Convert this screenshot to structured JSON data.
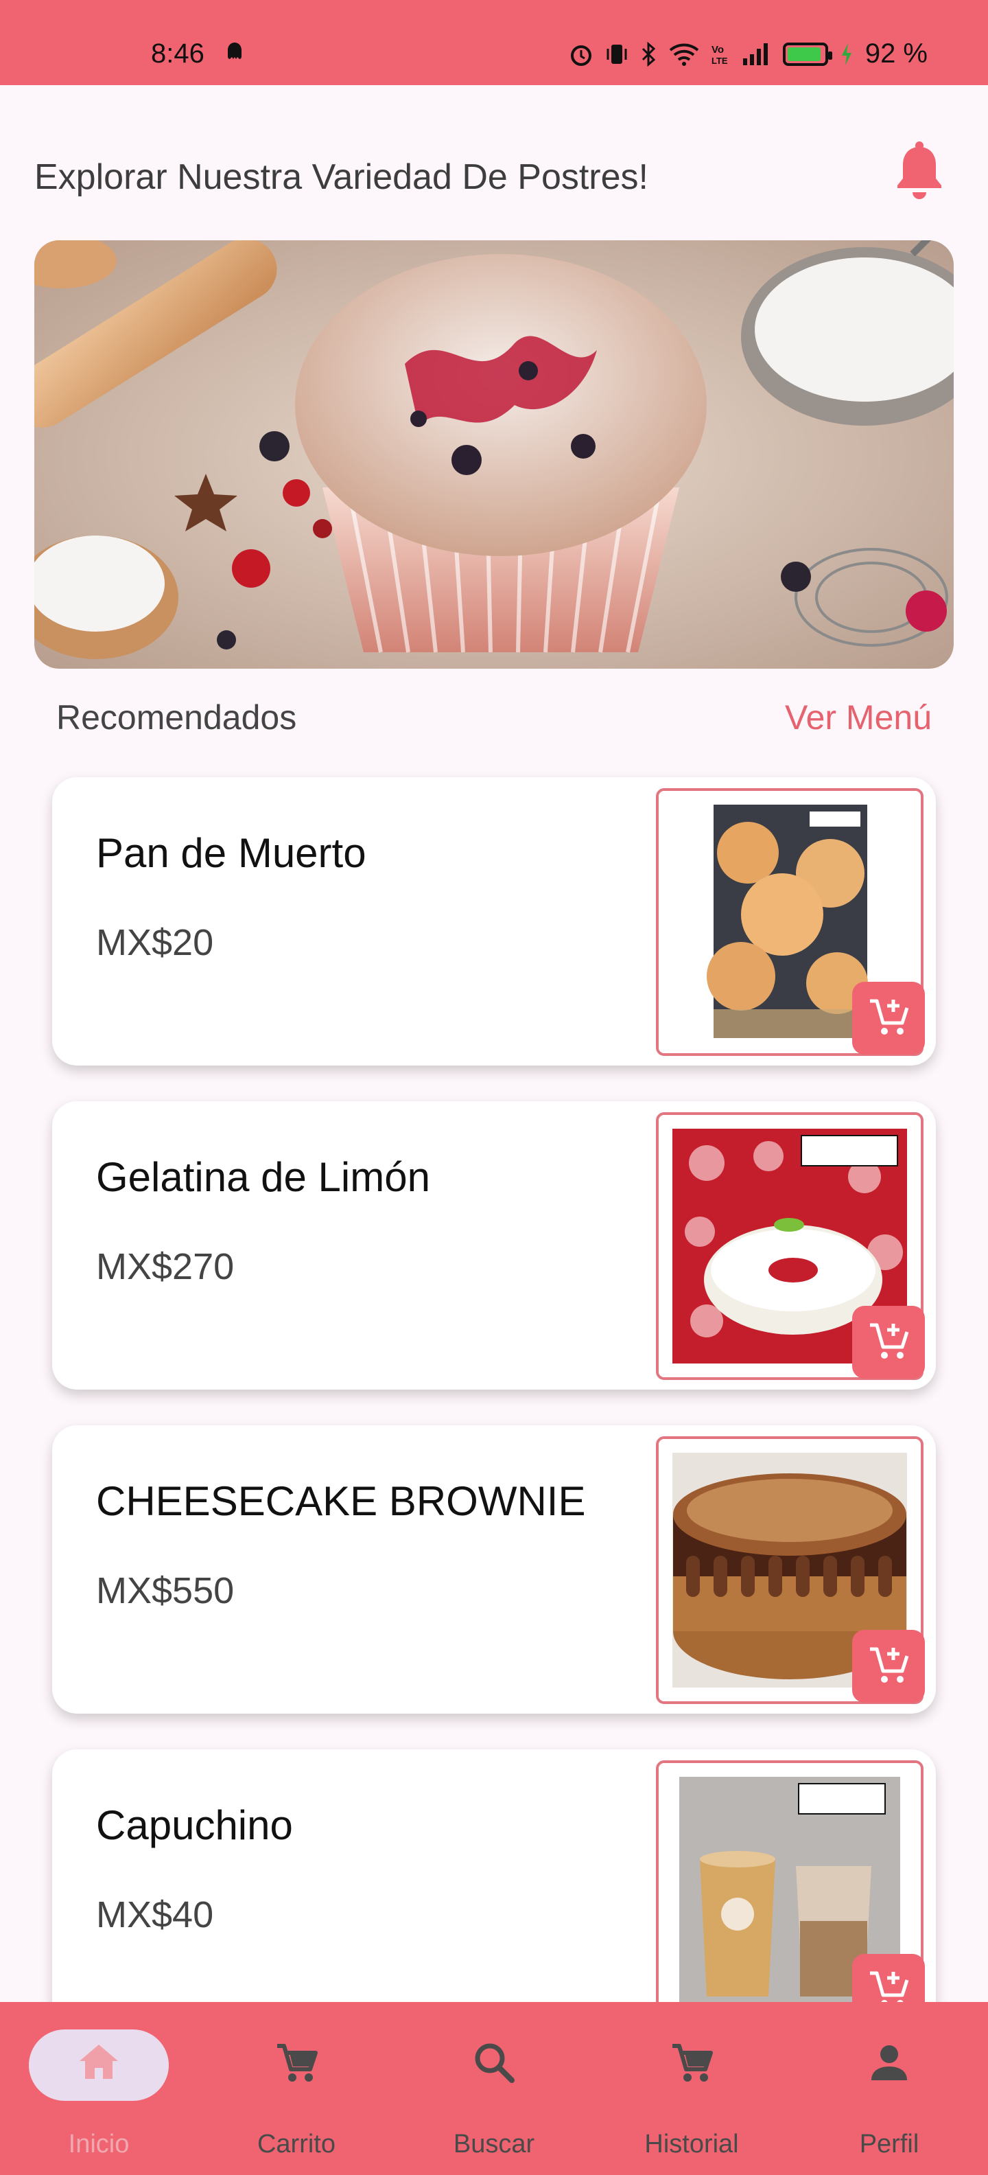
{
  "status": {
    "time": "8:46",
    "battery": "92 %",
    "battery_level": 0.92
  },
  "header": {
    "title": "Explorar Nuestra Variedad De Postres!"
  },
  "section": {
    "title": "Recomendados",
    "link": "Ver Menú"
  },
  "products": [
    {
      "name": "Pan de Muerto",
      "price": "MX$20"
    },
    {
      "name": "Gelatina de Limón",
      "price": "MX$270"
    },
    {
      "name": "CHEESECAKE BROWNIE",
      "price": "MX$550"
    },
    {
      "name": "Capuchino",
      "price": "MX$40"
    }
  ],
  "nav": [
    {
      "label": "Inicio",
      "icon": "home-icon"
    },
    {
      "label": "Carrito",
      "icon": "cart-icon"
    },
    {
      "label": "Buscar",
      "icon": "search-icon"
    },
    {
      "label": "Historial",
      "icon": "cart-icon"
    },
    {
      "label": "Perfil",
      "icon": "person-icon"
    }
  ],
  "colors": {
    "accent": "#ef6470",
    "background": "#fdf6fa",
    "link": "#e5636e"
  }
}
